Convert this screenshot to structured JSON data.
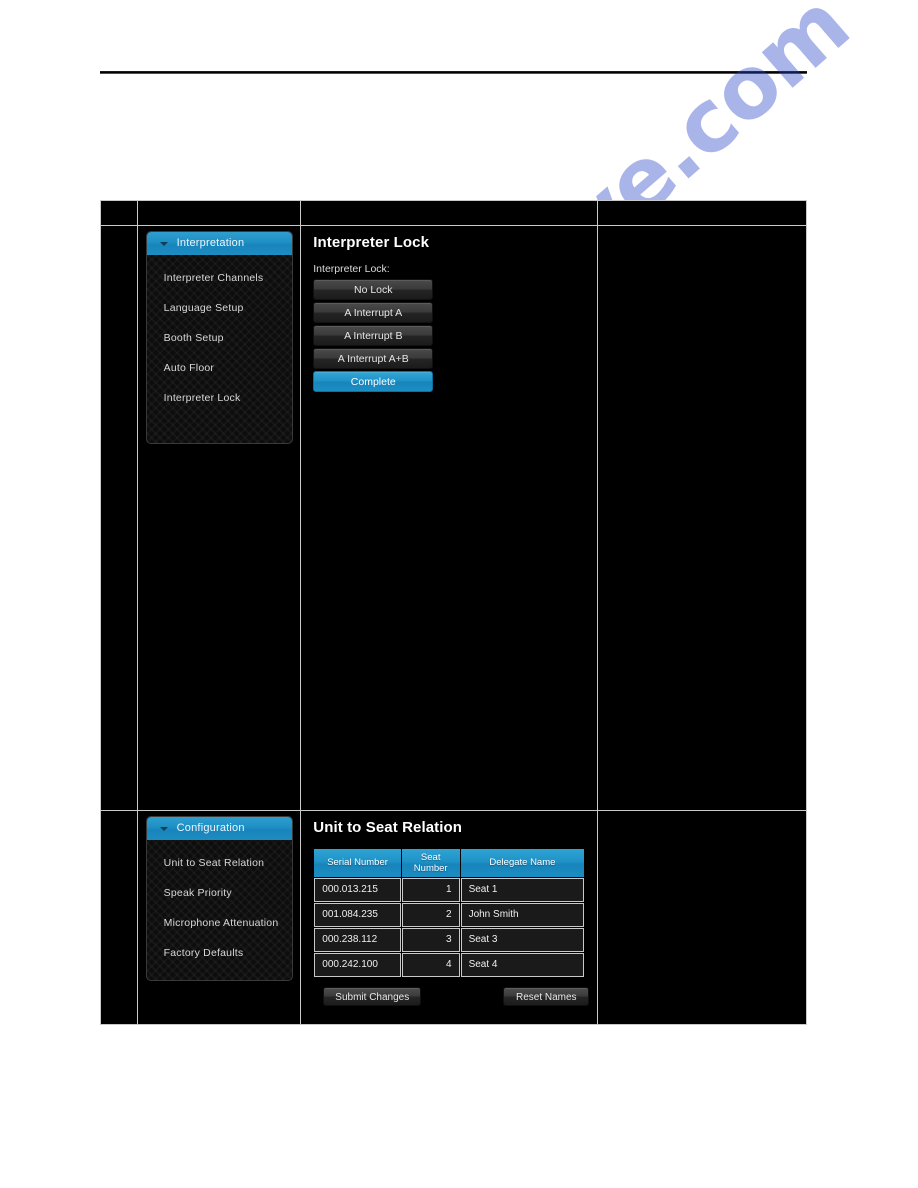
{
  "page": {
    "watermark": "manualshive.com"
  },
  "panel_top": {
    "nav": {
      "header": "Interpretation",
      "header_icon": "caret-down-icon",
      "items": [
        "Interpreter Channels",
        "Language Setup",
        "Booth Setup",
        "Auto Floor",
        "Interpreter Lock"
      ]
    },
    "content": {
      "title": "Interpreter Lock",
      "field_label": "Interpreter Lock:",
      "options": [
        {
          "label": "No Lock",
          "selected": false
        },
        {
          "label": "A Interrupt A",
          "selected": false
        },
        {
          "label": "A Interrupt B",
          "selected": false
        },
        {
          "label": "A Interrupt A+B",
          "selected": false
        },
        {
          "label": "Complete",
          "selected": true
        }
      ]
    }
  },
  "panel_bottom": {
    "nav": {
      "header": "Configuration",
      "header_icon": "caret-down-icon",
      "items": [
        "Unit to Seat Relation",
        "Speak Priority",
        "Microphone Attenuation",
        "Factory Defaults"
      ]
    },
    "content": {
      "title": "Unit to Seat Relation",
      "table": {
        "columns": [
          "Serial Number",
          "Seat\nNumber",
          "Delegate Name"
        ],
        "col_serial": "Serial Number",
        "col_seat_line1": "Seat",
        "col_seat_line2": "Number",
        "col_name": "Delegate Name",
        "rows": [
          {
            "serial": "000.013.215",
            "seat": "1",
            "name": "Seat 1"
          },
          {
            "serial": "001.084.235",
            "seat": "2",
            "name": "John Smith"
          },
          {
            "serial": "000.238.112",
            "seat": "3",
            "name": "Seat 3"
          },
          {
            "serial": "000.242.100",
            "seat": "4",
            "name": "Seat 4"
          }
        ]
      },
      "buttons": {
        "submit": "Submit Changes",
        "reset": "Reset Names"
      }
    }
  },
  "colors": {
    "accent": "#1f93c7",
    "panel_bg": "#0d0d0d",
    "page_bg": "#ffffff",
    "border": "#c9c9c9"
  }
}
